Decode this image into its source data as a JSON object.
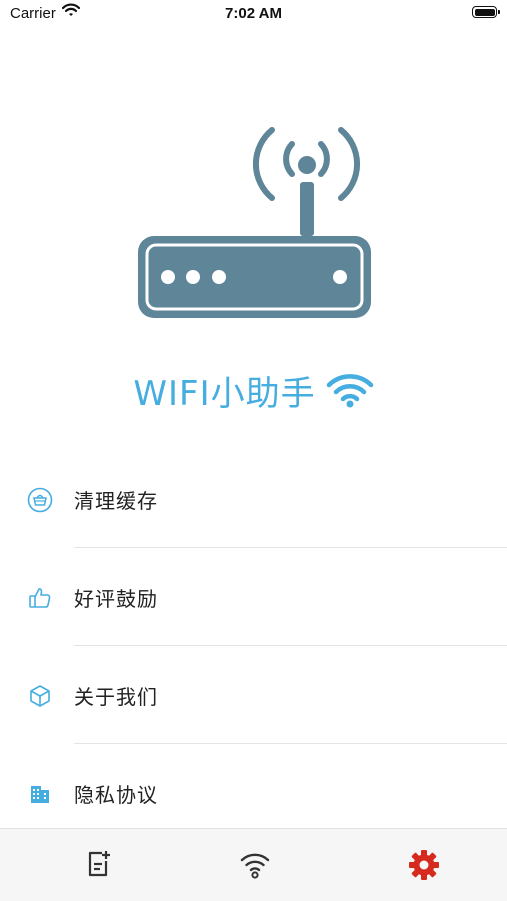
{
  "status_bar": {
    "carrier": "Carrier",
    "time": "7:02 AM"
  },
  "app": {
    "title": "WIFI小助手"
  },
  "menu": [
    {
      "label": "清理缓存",
      "icon": "basket-icon"
    },
    {
      "label": "好评鼓励",
      "icon": "thumbs-up-icon"
    },
    {
      "label": "关于我们",
      "icon": "cube-icon"
    },
    {
      "label": "隐私协议",
      "icon": "building-icon"
    }
  ],
  "tab_bar": {
    "tabs": [
      {
        "icon": "note-add-icon",
        "active": false
      },
      {
        "icon": "wifi-icon",
        "active": false
      },
      {
        "icon": "settings-gear-icon",
        "active": true
      }
    ]
  },
  "colors": {
    "accent": "#46ADE0",
    "router": "#5F8599",
    "active_tab": "#D62A1E",
    "inactive_tab": "#333333"
  }
}
